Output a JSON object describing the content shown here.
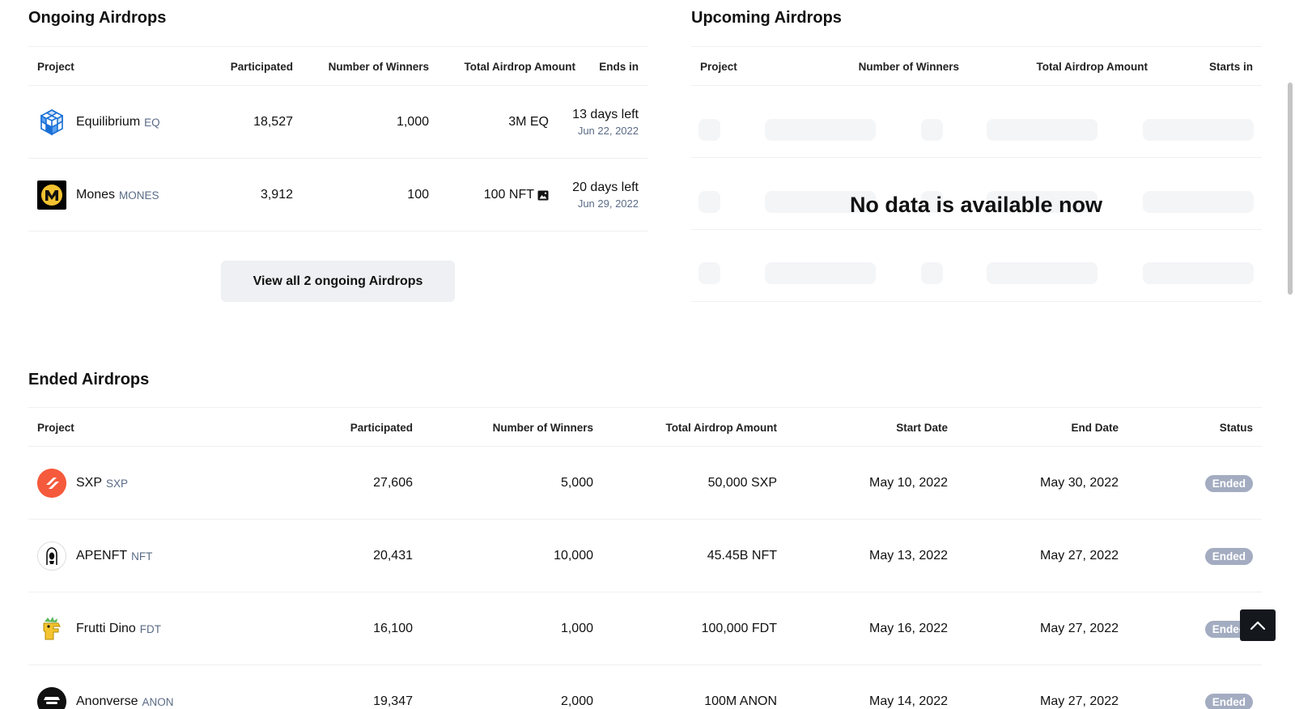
{
  "ongoing": {
    "title": "Ongoing Airdrops",
    "headers": {
      "project": "Project",
      "participated": "Participated",
      "winners": "Number of Winners",
      "amount": "Total Airdrop Amount",
      "ends": "Ends in"
    },
    "rows": [
      {
        "name": "Equilibrium",
        "symbol": "EQ",
        "logo_icon": "equilibrium-cube-logo",
        "participated": "18,527",
        "winners": "1,000",
        "amount": "3M EQ",
        "ends_big": "13 days left",
        "ends_date": "Jun 22, 2022"
      },
      {
        "name": "Mones",
        "symbol": "MONES",
        "logo_icon": "mones-m-logo",
        "participated": "3,912",
        "winners": "100",
        "amount": "100 NFT",
        "ends_big": "20 days left",
        "ends_date": "Jun 29, 2022"
      }
    ],
    "view_all_label": "View all 2 ongoing Airdrops"
  },
  "upcoming": {
    "title": "Upcoming Airdrops",
    "headers": {
      "project": "Project",
      "winners": "Number of Winners",
      "amount": "Total Airdrop Amount",
      "starts": "Starts in"
    },
    "empty_message": "No data is available now"
  },
  "ended": {
    "title": "Ended Airdrops",
    "headers": {
      "project": "Project",
      "participated": "Participated",
      "winners": "Number of Winners",
      "amount": "Total Airdrop Amount",
      "start": "Start Date",
      "end": "End Date",
      "status": "Status"
    },
    "rows": [
      {
        "name": "SXP",
        "symbol": "SXP",
        "logo_icon": "sxp-logo",
        "participated": "27,606",
        "winners": "5,000",
        "amount": "50,000 SXP",
        "start": "May 10, 2022",
        "end": "May 30, 2022",
        "status": "Ended"
      },
      {
        "name": "APENFT",
        "symbol": "NFT",
        "logo_icon": "apenft-logo",
        "participated": "20,431",
        "winners": "10,000",
        "amount": "45.45B NFT",
        "start": "May 13, 2022",
        "end": "May 27, 2022",
        "status": "Ended"
      },
      {
        "name": "Frutti Dino",
        "symbol": "FDT",
        "logo_icon": "frutti-dino-logo",
        "participated": "16,100",
        "winners": "1,000",
        "amount": "100,000 FDT",
        "start": "May 16, 2022",
        "end": "May 27, 2022",
        "status": "Ended"
      },
      {
        "name": "Anonverse",
        "symbol": "ANON",
        "logo_icon": "anonverse-logo",
        "participated": "19,347",
        "winners": "2,000",
        "amount": "100M ANON",
        "start": "May 14, 2022",
        "end": "May 27, 2022",
        "status": "Ended"
      }
    ]
  },
  "colors": {
    "badge_ended": "#a3acc0",
    "symbol_text": "#5a6b86",
    "button_bg": "#eef0f3",
    "skeleton": "#f4f5f7"
  }
}
